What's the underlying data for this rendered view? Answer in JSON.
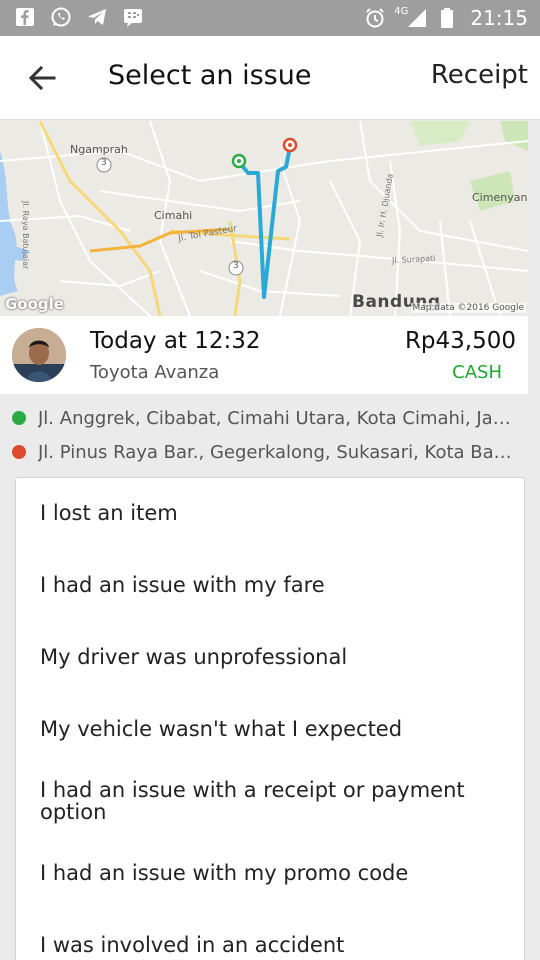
{
  "status_bar": {
    "time": "21:15",
    "network": "4G",
    "left_icons": [
      "facebook-icon",
      "whatsapp-icon",
      "telegram-icon",
      "bbm-icon"
    ],
    "right_icons": [
      "alarm-icon",
      "signal-icon",
      "battery-icon"
    ]
  },
  "app_bar": {
    "back_icon": "back-arrow-icon",
    "title": "Select an issue",
    "receipt_label": "Receipt"
  },
  "map": {
    "labels": {
      "ngamprah": "Ngamprah",
      "cimahi": "Cimahi",
      "tol": "Jl. Tol Pasteur",
      "cimenyan": "Cimenyan",
      "bandung": "Bandung",
      "surapati": "Jl. Surapati",
      "raya_batujajar": "Jl. Raya Batujajar",
      "h_djuanda": "Jl. Ir. H. Djuanda",
      "route_3a": "3",
      "route_3b": "3"
    },
    "google_logo": "Google",
    "attribution": "Map data ©2016 Google",
    "colors": {
      "route": "#29a9d6",
      "start": "#2bab46",
      "end": "#e04a2e"
    }
  },
  "trip": {
    "time": "Today at 12:32",
    "vehicle": "Toyota Avanza",
    "price": "Rp43,500",
    "payment": "CASH",
    "avatar_icon": "driver-avatar"
  },
  "addresses": {
    "pickup": "Jl. Anggrek, Cibabat, Cimahi Utara, Kota Cimahi, Jaw...",
    "dropoff": "Jl. Pinus Raya Bar., Gegerkalong, Sukasari, Kota Ban...",
    "pickup_color": "#2bab46",
    "dropoff_color": "#e04a2e"
  },
  "issues": [
    "I lost an item",
    "I had an issue with my fare",
    "My driver was unprofessional",
    "My vehicle wasn't what I expected",
    "I had an issue with a receipt or payment option",
    "I had an issue with my promo code",
    "I was involved in an accident"
  ]
}
